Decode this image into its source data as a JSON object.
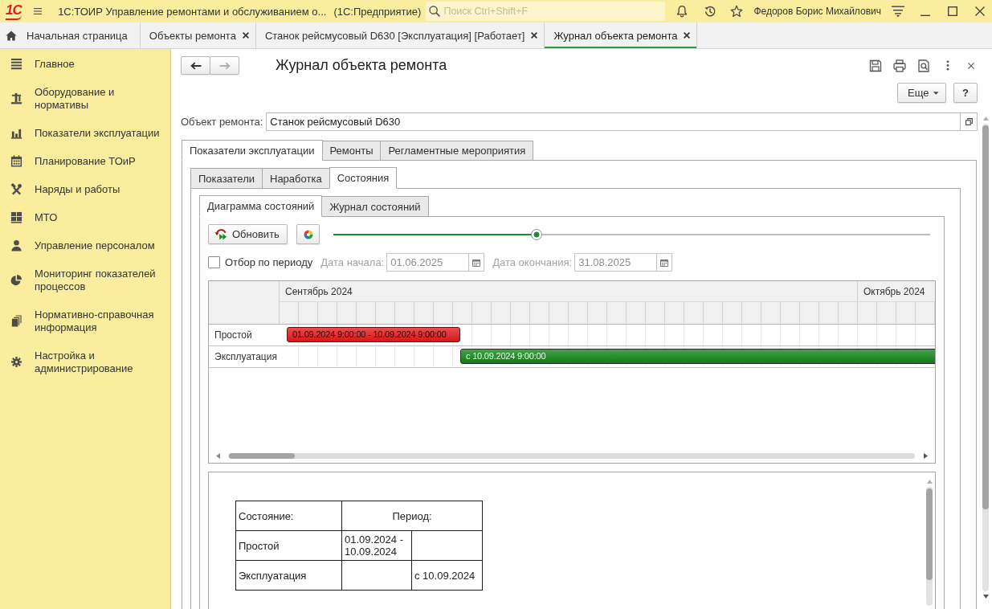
{
  "app_bar": {
    "logo": "1С",
    "title": "1С:ТОИР Управление ремонтами и обслуживанием о...",
    "platform": "(1С:Предприятие)",
    "search": {
      "placeholder": "Поиск Ctrl+Shift+F"
    },
    "user": "Федоров Борис Михайлович"
  },
  "open_tabs": [
    {
      "label": "Начальная страница",
      "kind": "home",
      "selected": false
    },
    {
      "label": "Объекты ремонта",
      "kind": "closable",
      "selected": false
    },
    {
      "label": "Станок рейсмусовый D630 [Эксплуатация] [Работает]",
      "kind": "closable",
      "selected": false
    },
    {
      "label": "Журнал объекта ремонта",
      "kind": "closable",
      "selected": true
    }
  ],
  "sidebar": {
    "items": [
      {
        "label": "Главное",
        "selected": false
      },
      {
        "label": "Оборудование и нормативы",
        "selected": false
      },
      {
        "label": "Показатели эксплуатации",
        "selected": false
      },
      {
        "label": "Планирование ТОиР",
        "selected": false
      },
      {
        "label": "Наряды и работы",
        "selected": false
      },
      {
        "label": "МТО",
        "selected": false
      },
      {
        "label": "Управление персоналом",
        "selected": false
      },
      {
        "label": "Мониторинг показателей процессов",
        "selected": false
      },
      {
        "label": "Нормативно-справочная информация",
        "selected": false
      },
      {
        "label": "Настройка и администрирование",
        "selected": false
      }
    ]
  },
  "form": {
    "nav": [
      {
        "kind": "back",
        "disabled": false
      },
      {
        "kind": "forward",
        "disabled": true
      }
    ],
    "title": "Журнал объекта ремонта",
    "more_button": "Еще",
    "help_button": "?",
    "object_field": {
      "label": "Объект ремонта:",
      "value": "Станок рейсмусовый D630"
    },
    "tabs": [
      {
        "label": "Показатели эксплуатации",
        "selected": true
      },
      {
        "label": "Ремонты",
        "selected": false
      },
      {
        "label": "Регламентные мероприятия",
        "selected": false
      }
    ],
    "subtabs": [
      {
        "label": "Показатели",
        "selected": false
      },
      {
        "label": "Наработка",
        "selected": false
      },
      {
        "label": "Состояния",
        "selected": true
      }
    ],
    "view_tabs": [
      {
        "label": "Диаграмма состояний",
        "selected": true
      },
      {
        "label": "Журнал состояний",
        "selected": false
      }
    ],
    "toolbar": {
      "refresh_button": "Обновить",
      "scale_slider": {
        "level": 0.34
      }
    },
    "period_filter": {
      "label": "Отбор по периоду",
      "checked": false,
      "start": {
        "label": "Дата начала:",
        "value": "01.06.2025",
        "disabled": true
      },
      "end": {
        "label": "Дата окончания:",
        "value": "31.08.2025",
        "disabled": true
      }
    },
    "gantt": {
      "months": [
        "Сентябрь 2024",
        "Октябрь 2024"
      ],
      "rows": [
        {
          "label": "Простой",
          "bar": {
            "text": "01.09.2024 9:00:00 - 10.09.2024 9:00:00",
            "color": "#e8191b"
          }
        },
        {
          "label": "Эксплуатация",
          "bar": {
            "text": "с 10.09.2024 9:00:00",
            "color": "#11861a"
          }
        }
      ]
    },
    "report": {
      "headers": [
        "Состояние:",
        "Период:"
      ],
      "rows": [
        {
          "state": "Простой",
          "column_2": "01.09.2024 - 10.09.2024"
        },
        {
          "state": "Эксплуатация",
          "column_3": "с 10.09.2024"
        }
      ]
    }
  }
}
